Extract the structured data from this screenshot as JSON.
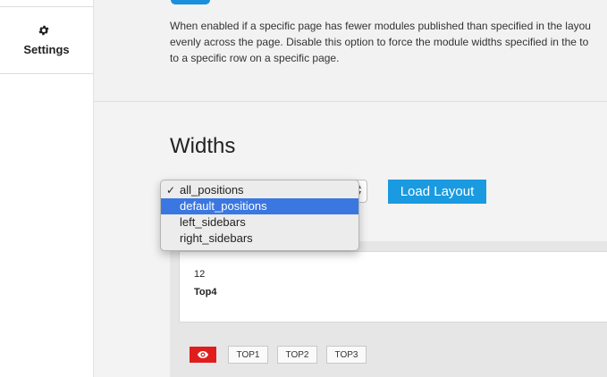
{
  "sidebar": {
    "settings": {
      "label": "Settings",
      "icon": "gear-icon"
    }
  },
  "top_panel": {
    "description_lines": [
      "When enabled if a specific page has fewer modules published than specified in the layou",
      "evenly across the page. Disable this option to force the module widths specified in the to",
      "to a specific row on a specific page."
    ]
  },
  "widths": {
    "title": "Widths",
    "select": {
      "selected": "all_positions",
      "highlighted": "default_positions",
      "options": [
        "all_positions",
        "default_positions",
        "left_sidebars",
        "right_sidebars"
      ]
    },
    "load_button": "Load Layout"
  },
  "layout": {
    "card": {
      "width_value": "12",
      "position_name": "Top4"
    },
    "buttons": [
      "TOP1",
      "TOP2",
      "TOP3"
    ],
    "eye_icon": "eye-icon"
  },
  "colors": {
    "accent": "#1a9ae0",
    "eye_button": "#e01d1d",
    "highlight": "#3b77e0"
  }
}
